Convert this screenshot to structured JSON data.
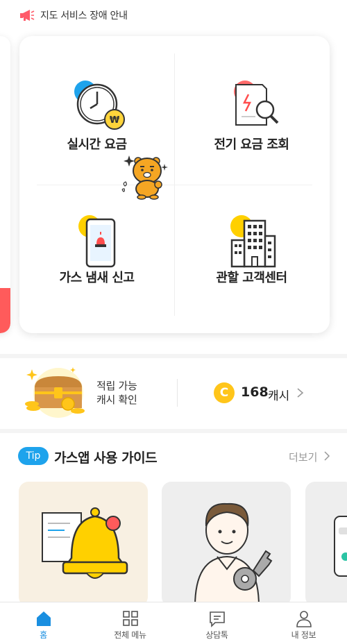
{
  "notice": {
    "text": "지도 서비스 장애 안내",
    "icon": "megaphone-icon"
  },
  "services": [
    {
      "label": "실시간 요금",
      "icon": "clock-won-icon"
    },
    {
      "label": "전기 요금 조회",
      "icon": "bill-search-icon"
    },
    {
      "label": "가스 냄새 신고",
      "icon": "phone-siren-icon"
    },
    {
      "label": "관할 고객센터",
      "icon": "building-icon"
    }
  ],
  "cash": {
    "desc_line1": "적립 가능",
    "desc_line2": "캐시 확인",
    "coin_symbol": "C",
    "amount": "168",
    "unit": "캐시"
  },
  "guide": {
    "tip_label": "Tip",
    "title": "가스앱 사용 가이드",
    "more_label": "더보기"
  },
  "tabs": [
    {
      "label": "홈",
      "icon": "home-icon",
      "active": true
    },
    {
      "label": "전체 메뉴",
      "icon": "grid-icon",
      "active": false
    },
    {
      "label": "상담톡",
      "icon": "chat-icon",
      "active": false
    },
    {
      "label": "내 정보",
      "icon": "person-icon",
      "active": false
    }
  ],
  "colors": {
    "accent_blue": "#1ea3ec",
    "active_tab": "#1a8fe0",
    "coin_yellow": "#ffc51a",
    "alert_red": "#ff5b5b"
  }
}
